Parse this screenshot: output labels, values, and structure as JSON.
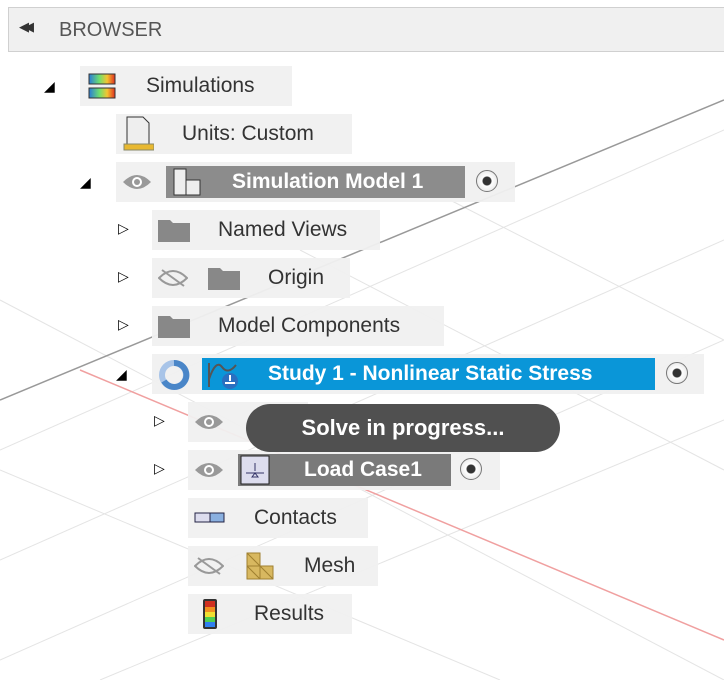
{
  "header": {
    "title": "BROWSER"
  },
  "tree": {
    "simulations": "Simulations",
    "units": "Units: Custom",
    "model": "Simulation Model 1",
    "named_views": "Named Views",
    "origin": "Origin",
    "model_components": "Model Components",
    "study": "Study 1 - Nonlinear Static Stress",
    "load_case": "Load Case1",
    "contacts": "Contacts",
    "mesh": "Mesh",
    "results": "Results"
  },
  "tooltip": "Solve in progress...",
  "colors": {
    "accent": "#0a96d8",
    "selected_gray": "#8c8c8c"
  }
}
